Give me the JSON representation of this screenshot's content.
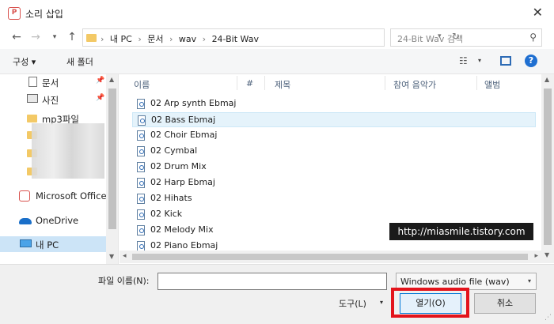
{
  "window": {
    "title": "소리 삽입",
    "close_label": "✕"
  },
  "address": {
    "crumbs": [
      "내 PC",
      "문서",
      "wav",
      "24-Bit Wav"
    ],
    "search_placeholder": "24-Bit Wav 검색"
  },
  "toolbar": {
    "organize": "구성 ▾",
    "new_folder": "새 폴더",
    "help": "?"
  },
  "nav": {
    "items": [
      {
        "label": "문서",
        "icon": "document-icon",
        "pinned": true
      },
      {
        "label": "사진",
        "icon": "pictures-icon",
        "pinned": true
      },
      {
        "label": "mp3파일",
        "icon": "folder-icon"
      },
      {
        "label": "Microsoft Office P",
        "icon": "office-icon"
      },
      {
        "label": "OneDrive",
        "icon": "onedrive-icon"
      },
      {
        "label": "내 PC",
        "icon": "computer-icon",
        "selected": true
      }
    ]
  },
  "columns": [
    "이름",
    "#",
    "제목",
    "참여 음악가",
    "앨범"
  ],
  "files": [
    "02 Arp synth Ebmaj",
    "02 Bass Ebmaj",
    "02 Choir Ebmaj",
    "02 Cymbal",
    "02 Drum Mix",
    "02 Harp Ebmaj",
    "02 Hihats",
    "02 Kick",
    "02 Melody Mix",
    "02 Piano Ebmaj"
  ],
  "selected_file_index": 1,
  "watermark": "http://miasmile.tistory.com",
  "footer": {
    "filename_label": "파일 이름(N):",
    "filename_value": "",
    "file_type": "Windows audio file (wav)",
    "tools": "도구(L)",
    "open": "열기(O)",
    "cancel": "취소"
  },
  "colors": {
    "highlight": "#e3141c",
    "selection": "#cce4f7",
    "accent": "#0078d7"
  }
}
